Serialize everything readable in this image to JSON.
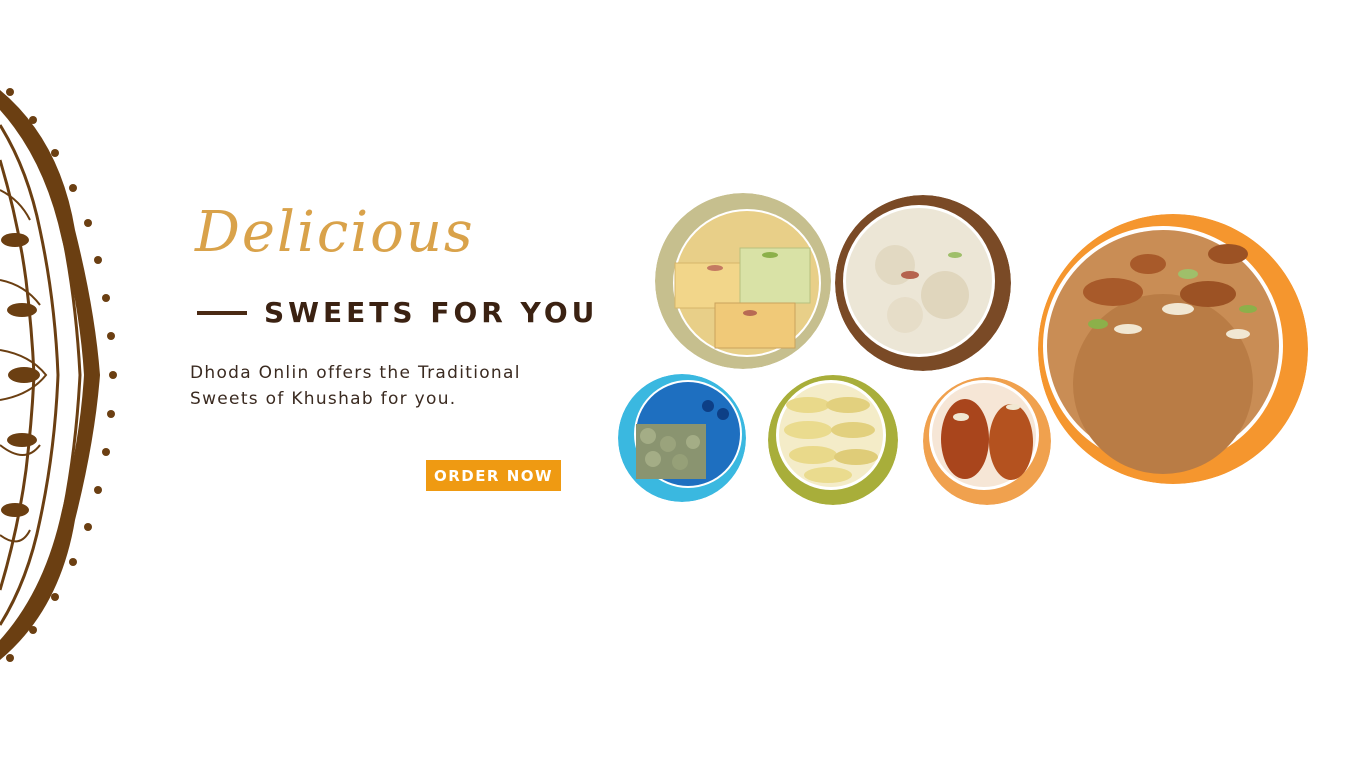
{
  "hero": {
    "title": "Delicious",
    "subtitle": "SWEETS FOR YOU",
    "description_line1": "Dhoda Onlin offers the Traditional",
    "description_line2": "Sweets of Khushab for you.",
    "cta_label": "ORDER NOW"
  },
  "colors": {
    "accent": "#ef9a12",
    "title": "#d9a24a",
    "heading": "#3b2212",
    "ornament": "#6b3f12",
    "ring_olive": "#c6bf8e",
    "ring_brown": "#7a4a26",
    "ring_orange": "#f5962e",
    "ring_blue": "#3ab8e0",
    "ring_green": "#a8ae3a",
    "ring_peach": "#f0a14e"
  },
  "images": [
    {
      "name": "barfi-image",
      "subject": "barfi"
    },
    {
      "name": "halwa-image",
      "subject": "white halwa"
    },
    {
      "name": "dhoda-image",
      "subject": "dhoda with almonds"
    },
    {
      "name": "green-sweets-image",
      "subject": "green sweets"
    },
    {
      "name": "patisa-image",
      "subject": "patisa"
    },
    {
      "name": "gulab-jamun-image",
      "subject": "gulab jamun"
    }
  ]
}
